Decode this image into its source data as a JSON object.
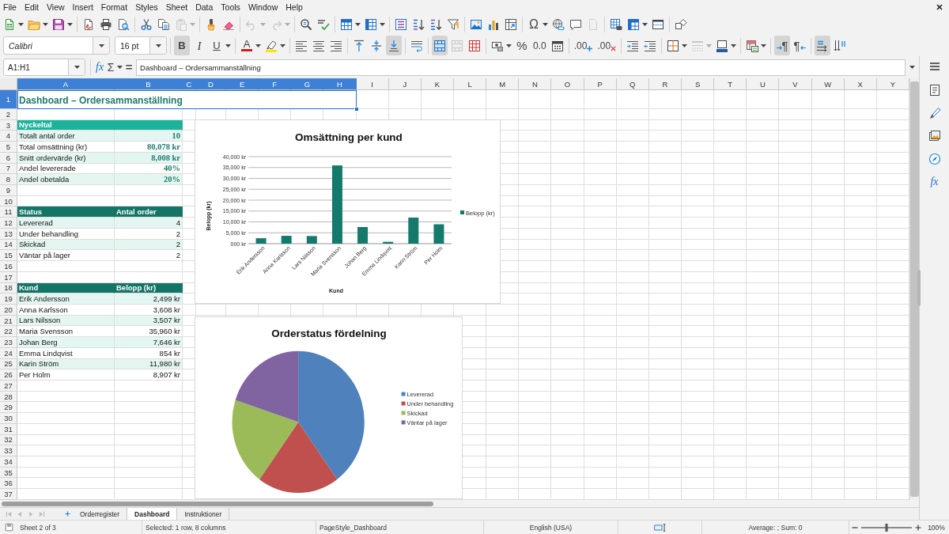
{
  "menu_bar": {
    "items": [
      "File",
      "Edit",
      "View",
      "Insert",
      "Format",
      "Styles",
      "Sheet",
      "Data",
      "Tools",
      "Window",
      "Help"
    ]
  },
  "standard_toolbar": {
    "groups": [
      [
        {
          "kind": "new",
          "menu": true,
          "disabled": false
        },
        {
          "kind": "open",
          "menu": true,
          "disabled": false
        },
        {
          "kind": "save",
          "menu": true,
          "disabled": false
        }
      ],
      [
        {
          "kind": "export-pdf",
          "menu": false,
          "disabled": false
        },
        {
          "kind": "print",
          "menu": false,
          "disabled": false
        },
        {
          "kind": "print-preview",
          "menu": false,
          "disabled": false
        }
      ],
      [
        {
          "kind": "cut",
          "menu": false,
          "disabled": false
        },
        {
          "kind": "copy",
          "menu": false,
          "disabled": false
        },
        {
          "kind": "paste",
          "menu": true,
          "disabled": true
        }
      ],
      [
        {
          "kind": "clone-formatting",
          "menu": false,
          "disabled": false
        },
        {
          "kind": "clear-formatting",
          "menu": false,
          "disabled": false
        }
      ],
      [
        {
          "kind": "undo",
          "menu": true,
          "disabled": true
        },
        {
          "kind": "redo",
          "menu": true,
          "disabled": true
        }
      ],
      [
        {
          "kind": "find-replace",
          "menu": false,
          "disabled": false
        },
        {
          "kind": "spelling",
          "menu": false,
          "disabled": false
        }
      ],
      [
        {
          "kind": "row",
          "menu": true,
          "disabled": false
        },
        {
          "kind": "column",
          "menu": true,
          "disabled": false
        }
      ],
      [
        {
          "kind": "sort",
          "menu": false,
          "disabled": false
        },
        {
          "kind": "sort-ascending",
          "menu": false,
          "disabled": false
        },
        {
          "kind": "sort-descending",
          "menu": false,
          "disabled": false
        },
        {
          "kind": "autofilter",
          "menu": false,
          "disabled": false
        }
      ],
      [
        {
          "kind": "image",
          "menu": false,
          "disabled": false
        },
        {
          "kind": "chart",
          "menu": false,
          "disabled": false
        },
        {
          "kind": "pivot-table",
          "menu": false,
          "disabled": false
        }
      ],
      [
        {
          "kind": "special-character",
          "label": "Ω",
          "menu": true,
          "disabled": false
        },
        {
          "kind": "hyperlink",
          "menu": false,
          "disabled": false
        },
        {
          "kind": "comment",
          "menu": false,
          "disabled": false
        },
        {
          "kind": "header-footer",
          "menu": false,
          "disabled": true
        }
      ],
      [
        {
          "kind": "print-area",
          "menu": false,
          "disabled": false
        },
        {
          "kind": "freeze",
          "menu": true,
          "disabled": false
        },
        {
          "kind": "split-window",
          "menu": false,
          "disabled": false
        }
      ],
      [
        {
          "kind": "draw-functions",
          "menu": false,
          "disabled": false
        }
      ]
    ]
  },
  "formatting_toolbar": {
    "font_name": {
      "value": "Calibri"
    },
    "font_size": {
      "value": "16 pt"
    },
    "groups": [
      [
        {
          "kind": "bold",
          "label": "B",
          "menu": false,
          "on": true,
          "disabled": false
        },
        {
          "kind": "italic",
          "label": "I",
          "menu": false,
          "on": false,
          "disabled": false
        },
        {
          "kind": "underline",
          "label": "U",
          "menu": true,
          "on": false,
          "disabled": false
        }
      ],
      [
        {
          "kind": "font-color",
          "label": "A",
          "menu": true,
          "on": false,
          "disabled": false
        },
        {
          "kind": "highlight",
          "menu": true,
          "on": false,
          "disabled": false
        }
      ],
      [
        {
          "kind": "align-left",
          "menu": false,
          "on": false,
          "disabled": false
        },
        {
          "kind": "align-center",
          "menu": false,
          "on": false,
          "disabled": false
        },
        {
          "kind": "align-right",
          "menu": false,
          "on": false,
          "disabled": false
        }
      ],
      [
        {
          "kind": "align-top",
          "menu": false,
          "on": false,
          "disabled": false
        },
        {
          "kind": "align-middle",
          "menu": false,
          "on": false,
          "disabled": false
        },
        {
          "kind": "align-bottom",
          "menu": false,
          "on": true,
          "disabled": false
        }
      ],
      [
        {
          "kind": "wrap-text",
          "menu": false,
          "on": false,
          "disabled": false
        }
      ],
      [
        {
          "kind": "merge-center",
          "menu": false,
          "on": true,
          "disabled": false
        },
        {
          "kind": "merge",
          "menu": false,
          "on": false,
          "disabled": true
        },
        {
          "kind": "unmerge",
          "menu": false,
          "on": false,
          "disabled": false
        }
      ],
      [
        {
          "kind": "currency",
          "menu": true,
          "on": false,
          "disabled": false
        },
        {
          "kind": "percent",
          "label": "%",
          "menu": false,
          "on": false,
          "disabled": false
        },
        {
          "kind": "number",
          "label": "0.0",
          "menu": false,
          "on": false,
          "disabled": false
        },
        {
          "kind": "date",
          "menu": false,
          "on": false,
          "disabled": false
        }
      ],
      [
        {
          "kind": "add-decimal",
          "label": ".00",
          "menu": false,
          "on": false,
          "disabled": false
        },
        {
          "kind": "delete-decimal",
          "label": ".00",
          "menu": false,
          "on": false,
          "disabled": false
        }
      ],
      [
        {
          "kind": "indent-increase",
          "menu": false,
          "on": false,
          "disabled": false
        },
        {
          "kind": "indent-decrease",
          "menu": false,
          "on": false,
          "disabled": false
        }
      ],
      [
        {
          "kind": "borders",
          "menu": true,
          "on": false,
          "disabled": false
        },
        {
          "kind": "border-style",
          "menu": true,
          "on": false,
          "disabled": true
        },
        {
          "kind": "border-color",
          "menu": true,
          "on": false,
          "disabled": false
        }
      ],
      [
        {
          "kind": "conditional",
          "menu": true,
          "on": false,
          "disabled": false
        }
      ],
      [
        {
          "kind": "ltr",
          "label": "¶",
          "menu": false,
          "on": true,
          "disabled": false
        },
        {
          "kind": "rtl",
          "label": "¶",
          "menu": false,
          "on": false,
          "disabled": false
        }
      ],
      [
        {
          "kind": "text-ltr",
          "menu": false,
          "on": true,
          "disabled": false
        },
        {
          "kind": "text-ttb",
          "menu": false,
          "on": false,
          "disabled": false
        }
      ]
    ]
  },
  "formula_bar": {
    "name_box": {
      "value": "A1:H1"
    },
    "buttons": [
      {
        "kind": "function-wizard",
        "label": "fx",
        "menu": false
      },
      {
        "kind": "sum",
        "label": "Σ",
        "menu": true
      },
      {
        "kind": "formula",
        "label": "=",
        "menu": false
      }
    ],
    "input": {
      "value": "Dashboard – Ordersammanställning"
    }
  },
  "sidebar": {
    "buttons": [
      {
        "kind": "menu"
      },
      {
        "kind": "properties"
      },
      {
        "kind": "styles"
      },
      {
        "kind": "gallery"
      },
      {
        "kind": "navigator"
      },
      {
        "kind": "functions",
        "label": "fx"
      }
    ]
  },
  "sheet": {
    "columns": [
      {
        "label": "A",
        "selected": true
      },
      {
        "label": "B",
        "selected": true
      },
      {
        "label": "C",
        "selected": true
      },
      {
        "label": "D",
        "selected": true
      },
      {
        "label": "E",
        "selected": true
      },
      {
        "label": "F",
        "selected": true
      },
      {
        "label": "G",
        "selected": true
      },
      {
        "label": "H",
        "selected": true
      },
      {
        "label": "I",
        "selected": false
      },
      {
        "label": "J",
        "selected": false
      },
      {
        "label": "K",
        "selected": false
      },
      {
        "label": "L",
        "selected": false
      },
      {
        "label": "M",
        "selected": false
      },
      {
        "label": "N",
        "selected": false
      },
      {
        "label": "O",
        "selected": false
      },
      {
        "label": "P",
        "selected": false
      },
      {
        "label": "Q",
        "selected": false
      },
      {
        "label": "R",
        "selected": false
      },
      {
        "label": "S",
        "selected": false
      },
      {
        "label": "T",
        "selected": false
      },
      {
        "label": "U",
        "selected": false
      },
      {
        "label": "V",
        "selected": false
      },
      {
        "label": "W",
        "selected": false
      },
      {
        "label": "X",
        "selected": false
      },
      {
        "label": "Y",
        "selected": false
      }
    ],
    "rows": [
      {
        "number": "1",
        "selected": true,
        "kind": "title",
        "text": "Dashboard – Ordersammanställning"
      },
      {
        "number": "2",
        "selected": false,
        "kind": "blank"
      },
      {
        "number": "3",
        "selected": false,
        "kind": "key-header",
        "label": "Nyckeltal"
      },
      {
        "number": "4",
        "selected": false,
        "kind": "key",
        "label": "Totalt antal order",
        "value": "10",
        "shaded": true
      },
      {
        "number": "5",
        "selected": false,
        "kind": "key",
        "label": "Total omsättning (kr)",
        "value": "80,078 kr",
        "shaded": false
      },
      {
        "number": "6",
        "selected": false,
        "kind": "key",
        "label": "Snitt ordervärde (kr)",
        "value": "8,008 kr",
        "shaded": true
      },
      {
        "number": "7",
        "selected": false,
        "kind": "key",
        "label": "Andel levererade",
        "value": "40%",
        "shaded": false
      },
      {
        "number": "8",
        "selected": false,
        "kind": "key",
        "label": "Andel obetalda",
        "value": "20%",
        "shaded": true
      },
      {
        "number": "9",
        "selected": false,
        "kind": "blank"
      },
      {
        "number": "10",
        "selected": false,
        "kind": "blank"
      },
      {
        "number": "11",
        "selected": false,
        "kind": "table-header",
        "label": "Status",
        "value": "Antal order"
      },
      {
        "number": "12",
        "selected": false,
        "kind": "item",
        "label": "Levererad",
        "value": "4",
        "shaded": true
      },
      {
        "number": "13",
        "selected": false,
        "kind": "item",
        "label": "Under behandling",
        "value": "2",
        "shaded": false
      },
      {
        "number": "14",
        "selected": false,
        "kind": "item",
        "label": "Skickad",
        "value": "2",
        "shaded": true
      },
      {
        "number": "15",
        "selected": false,
        "kind": "item",
        "label": "Väntar på lager",
        "value": "2",
        "shaded": false
      },
      {
        "number": "16",
        "selected": false,
        "kind": "blank"
      },
      {
        "number": "17",
        "selected": false,
        "kind": "blank"
      },
      {
        "number": "18",
        "selected": false,
        "kind": "table-header",
        "label": "Kund",
        "value": "Belopp (kr)"
      },
      {
        "number": "19",
        "selected": false,
        "kind": "item",
        "label": "Erik Andersson",
        "value": "2,499 kr",
        "shaded": true
      },
      {
        "number": "20",
        "selected": false,
        "kind": "item",
        "label": "Anna Karlsson",
        "value": "3,608 kr",
        "shaded": false
      },
      {
        "number": "21",
        "selected": false,
        "kind": "item",
        "label": "Lars Nilsson",
        "value": "3,507 kr",
        "shaded": true
      },
      {
        "number": "22",
        "selected": false,
        "kind": "item",
        "label": "Maria Svensson",
        "value": "35,960 kr",
        "shaded": false
      },
      {
        "number": "23",
        "selected": false,
        "kind": "item",
        "label": "Johan Berg",
        "value": "7,646 kr",
        "shaded": true
      },
      {
        "number": "24",
        "selected": false,
        "kind": "item",
        "label": "Emma Lindqvist",
        "value": "854 kr",
        "shaded": false
      },
      {
        "number": "25",
        "selected": false,
        "kind": "item",
        "label": "Karin Ström",
        "value": "11,980 kr",
        "shaded": true
      },
      {
        "number": "26",
        "selected": false,
        "kind": "item",
        "label": "Per Holm",
        "value": "8,907 kr",
        "shaded": false
      },
      {
        "number": "27",
        "selected": false,
        "kind": "blank"
      },
      {
        "number": "28",
        "selected": false,
        "kind": "blank"
      },
      {
        "number": "29",
        "selected": false,
        "kind": "blank"
      },
      {
        "number": "30",
        "selected": false,
        "kind": "blank"
      },
      {
        "number": "31",
        "selected": false,
        "kind": "blank"
      },
      {
        "number": "32",
        "selected": false,
        "kind": "blank"
      },
      {
        "number": "33",
        "selected": false,
        "kind": "blank"
      },
      {
        "number": "34",
        "selected": false,
        "kind": "blank"
      },
      {
        "number": "35",
        "selected": false,
        "kind": "blank"
      },
      {
        "number": "36",
        "selected": false,
        "kind": "blank"
      },
      {
        "number": "37",
        "selected": false,
        "kind": "blank"
      }
    ],
    "charts": [
      {
        "chart_data": {
          "type": "bar",
          "title": "Omsättning per kund",
          "xlabel": "Kund",
          "ylabel": "Belopp (kr)",
          "categories": [
            "Erik Andersson",
            "Anna Karlsson",
            "Lars Nilsson",
            "Maria Svensson",
            "Johan Berg",
            "Emma Lindqvist",
            "Karin Ström",
            "Per Holm"
          ],
          "series": [
            {
              "name": "Belopp (kr)",
              "color": "#137a6c",
              "values": [
                2499,
                3608,
                3507,
                35960,
                7646,
                854,
                11980,
                8907
              ]
            }
          ],
          "ylim": [
            0,
            40000
          ],
          "yticks": [
            {
              "value": 0,
              "label": "000 kr"
            },
            {
              "value": 5000,
              "label": "5,000 kr"
            },
            {
              "value": 10000,
              "label": "10,000 kr"
            },
            {
              "value": 15000,
              "label": "15,000 kr"
            },
            {
              "value": 20000,
              "label": "20,000 kr"
            },
            {
              "value": 25000,
              "label": "25,000 kr"
            },
            {
              "value": 30000,
              "label": "30,000 kr"
            },
            {
              "value": 35000,
              "label": "35,000 kr"
            },
            {
              "value": 40000,
              "label": "40,000 kr"
            }
          ],
          "grid": true,
          "legend": "right"
        }
      },
      {
        "chart_data": {
          "type": "pie",
          "title": "Orderstatus fördelning",
          "categories": [
            "Levererad",
            "Under behandling",
            "Skickad",
            "Väntar på lager"
          ],
          "values": [
            40,
            20,
            20,
            20
          ],
          "colors": [
            "#4f81bd",
            "#c0504d",
            "#9bbb59",
            "#8064a2"
          ],
          "legend": "right"
        }
      }
    ]
  },
  "sheet_tabs": {
    "navigation": [
      {
        "kind": "first",
        "disabled": true
      },
      {
        "kind": "previous",
        "disabled": true
      },
      {
        "kind": "next",
        "disabled": true
      },
      {
        "kind": "last",
        "disabled": true
      }
    ],
    "tabs": [
      {
        "label": "Orderregister",
        "selected": false
      },
      {
        "label": "Dashboard",
        "selected": true
      },
      {
        "label": "Instruktioner",
        "selected": false
      }
    ]
  },
  "status_bar": {
    "sheet": "Sheet 2 of 3",
    "selection": "Selected: 1 row, 8 columns",
    "page_style": "PageStyle_Dashboard",
    "language": "English (USA)",
    "summary": "Average: ; Sum: 0",
    "zoom": {
      "level": 0.5,
      "value": "100%"
    }
  }
}
